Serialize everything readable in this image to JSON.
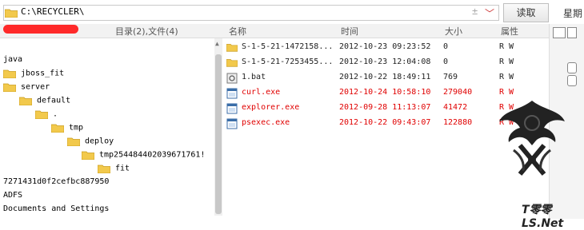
{
  "toolbar": {
    "path": "C:\\RECYCLER\\",
    "spin_symbol": "±",
    "dropdown_symbol": "﹀",
    "read_button": "读取",
    "side_label": "星期"
  },
  "header": {
    "dir_count": "目录(2),文件(4)",
    "columns": [
      "名称",
      "时间",
      "大小",
      "属性"
    ]
  },
  "tree": [
    {
      "label": "java",
      "folder": false
    },
    {
      "label": "jboss_fit",
      "folder": true
    },
    {
      "label": "server",
      "folder": true
    },
    {
      "label": "default",
      "folder": true
    },
    {
      "label": ".",
      "folder": true
    },
    {
      "label": "tmp",
      "folder": true
    },
    {
      "label": "deploy",
      "folder": true
    },
    {
      "label": "tmp254484402039671761!",
      "folder": true
    },
    {
      "label": "fit",
      "folder": true
    },
    {
      "label": "7271431d0f2cefbc887950",
      "folder": false
    },
    {
      "label": "ADFS",
      "folder": false
    },
    {
      "label": "Documents and Settings",
      "folder": false
    }
  ],
  "files": [
    {
      "name": "S-1-5-21-1472158...",
      "time": "2012-10-23 09:23:52",
      "size": "0",
      "attr": "R W",
      "type": "folder",
      "highlight": false
    },
    {
      "name": "S-1-5-21-7253455...",
      "time": "2012-10-23 12:04:08",
      "size": "0",
      "attr": "R W",
      "type": "folder",
      "highlight": false
    },
    {
      "name": "1.bat",
      "time": "2012-10-22 18:49:11",
      "size": "769",
      "attr": "R W",
      "type": "bat",
      "highlight": false
    },
    {
      "name": "curl.exe",
      "time": "2012-10-24 10:58:10",
      "size": "279040",
      "attr": "R W",
      "type": "exe",
      "highlight": true
    },
    {
      "name": "explorer.exe",
      "time": "2012-09-28 11:13:07",
      "size": "41472",
      "attr": "R W",
      "type": "exe",
      "highlight": true
    },
    {
      "name": "psexec.exe",
      "time": "2012-10-22 09:43:07",
      "size": "122880",
      "attr": "R W",
      "type": "exe",
      "highlight": true
    }
  ],
  "watermark": {
    "prefix": "T",
    "middle": "零零LS.",
    "suffix": "Net"
  },
  "colors": {
    "highlight": "#e00000",
    "folder": "#f2c94c",
    "redact": "#ff2a2a"
  }
}
